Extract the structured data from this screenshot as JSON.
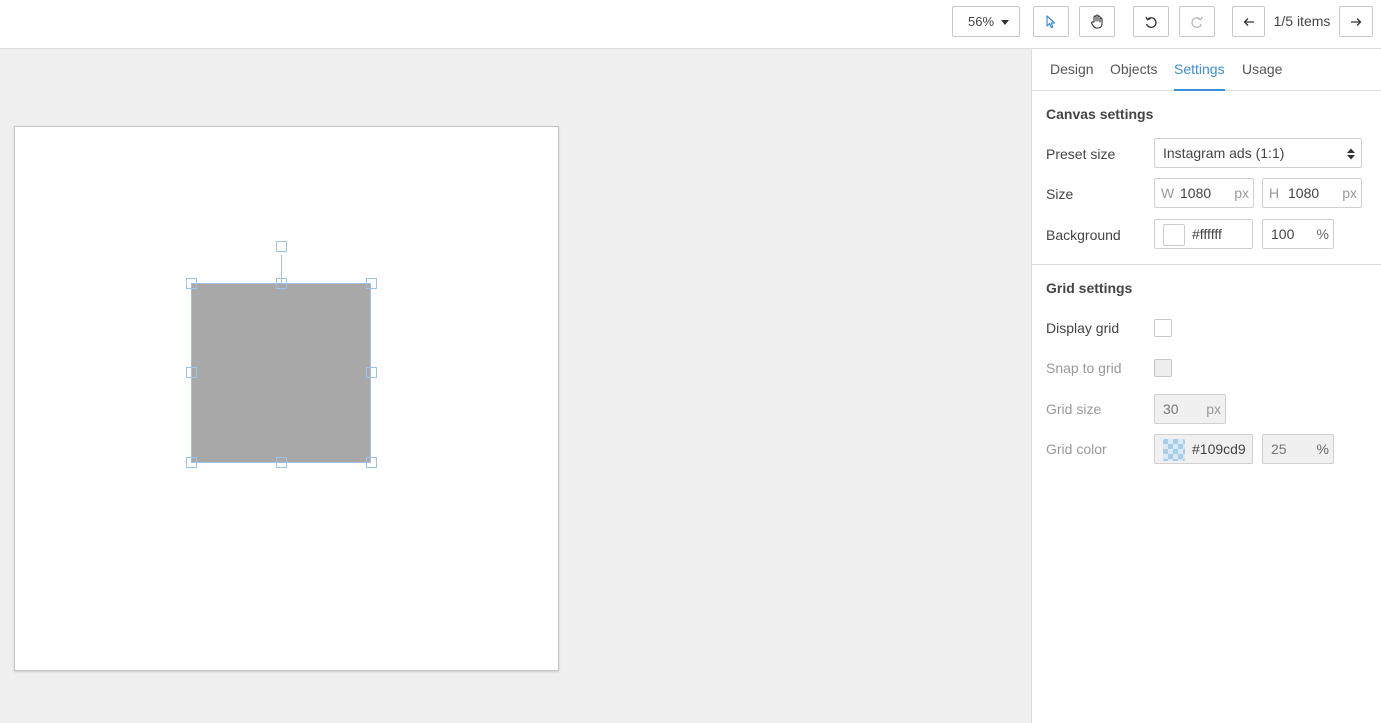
{
  "toolbar": {
    "zoom_label": "56%",
    "items_count": "1/5 items",
    "icons": {
      "zoom_caret": "chevron-down-icon",
      "pointer": "cursor-arrow-icon",
      "hand": "hand-pan-icon",
      "undo": "undo-icon",
      "redo": "redo-icon",
      "prev": "arrow-left-icon",
      "next": "arrow-right-icon"
    }
  },
  "tabs": [
    {
      "label": "Design"
    },
    {
      "label": "Objects"
    },
    {
      "label": "Settings",
      "active": true
    },
    {
      "label": "Usage"
    }
  ],
  "canvas_settings": {
    "title": "Canvas settings",
    "preset_label": "Preset size",
    "preset_value": "Instagram ads (1:1)",
    "size_label": "Size",
    "width_prefix": "W",
    "width_value": "1080",
    "width_unit": "px",
    "height_prefix": "H",
    "height_value": "1080",
    "height_unit": "px",
    "background_label": "Background",
    "background_color": "#ffffff",
    "background_opacity": "100",
    "opacity_unit": "%"
  },
  "grid_settings": {
    "title": "Grid settings",
    "display_label": "Display grid",
    "display_checked": false,
    "snap_label": "Snap to grid",
    "snap_checked": false,
    "size_label": "Grid size",
    "size_value": "30",
    "size_unit": "px",
    "color_label": "Grid color",
    "color_value": "#109cd9",
    "color_opacity": "25",
    "opacity_unit": "%"
  },
  "colors": {
    "accent": "#3b8fd8",
    "shape_fill": "#a8a8a8",
    "selection": "#9ec3e6"
  }
}
